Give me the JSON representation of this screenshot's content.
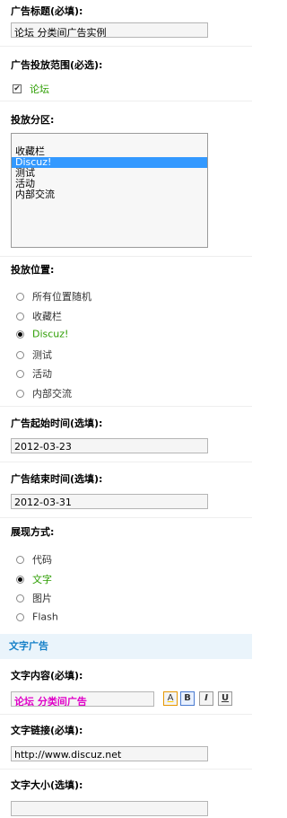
{
  "ad_title": {
    "label": "广告标题(必填):",
    "value": "论坛 分类间广告实例"
  },
  "ad_scope": {
    "label": "广告投放范围(必选):",
    "option": "论坛",
    "checked": true
  },
  "ad_zone": {
    "label": "投放分区:",
    "items": [
      "收藏栏",
      "Discuz!",
      "测试",
      "活动",
      "内部交流"
    ],
    "selected": "Discuz!"
  },
  "ad_position": {
    "label": "投放位置:",
    "options": [
      "所有位置随机",
      "收藏栏",
      "Discuz!",
      "测试",
      "活动",
      "内部交流"
    ],
    "selected": "Discuz!"
  },
  "start_time": {
    "label": "广告起始时间(选填):",
    "value": "2012-03-23"
  },
  "end_time": {
    "label": "广告结束时间(选填):",
    "value": "2012-03-31"
  },
  "display_mode": {
    "label": "展现方式:",
    "options": [
      "代码",
      "文字",
      "图片",
      "Flash"
    ],
    "selected": "文字"
  },
  "text_ad": {
    "heading": "文字广告",
    "content": {
      "label": "文字内容(必填):",
      "value": "论坛 分类间广告",
      "color": "#e000c8"
    },
    "toolbar": {
      "color": "A",
      "bold": "B",
      "italic": "I",
      "underline": "U"
    },
    "link": {
      "label": "文字链接(必填):",
      "value": "http://www.discuz.net"
    },
    "size": {
      "label": "文字大小(选填):",
      "value": ""
    }
  },
  "colors": {
    "selected_green": "#2c9d00",
    "section_bg": "#eaf4fb",
    "section_text": "#1680c8",
    "list_highlight": "#3399ff"
  }
}
